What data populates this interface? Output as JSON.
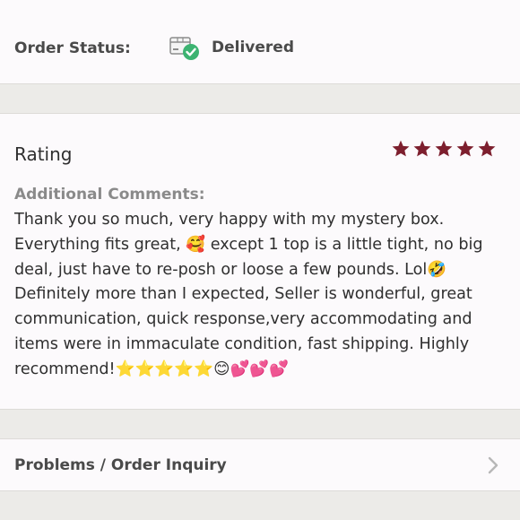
{
  "order_status": {
    "label": "Order Status:",
    "value": "Delivered",
    "icon": "delivered-box-icon",
    "icon_check_color": "#3cb371"
  },
  "rating": {
    "title": "Rating",
    "stars": 5,
    "max_stars": 5,
    "star_color": "#7d1f2e",
    "comments_label": "Additional Comments:",
    "comment": "Thank you so much, very happy with my mystery box. Everything fits great, 🥰 except 1 top is a little tight, no big deal, just have to re-posh or loose a few pounds. Lol🤣 Definitely more than I expected, Seller is wonderful, great communication, quick response,very accommodating and items were in immaculate condition, fast shipping. Highly recommend!⭐️⭐️⭐️⭐️⭐️😊💕💕💕"
  },
  "problems": {
    "label": "Problems / Order Inquiry",
    "icon": "chevron-right-icon"
  }
}
